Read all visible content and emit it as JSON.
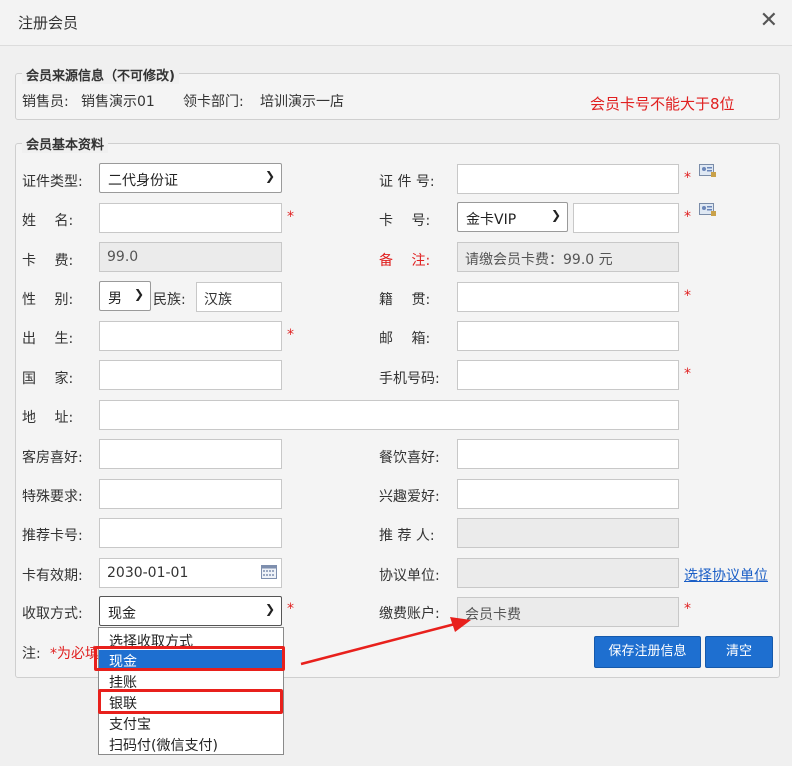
{
  "window": {
    "title": "注册会员",
    "close_icon": "close-icon"
  },
  "source_info": {
    "legend": "会员来源信息（不可修改)",
    "salesperson_label": "销售员:",
    "salesperson_value": "销售演示01",
    "dept_label": "领卡部门:",
    "dept_value": "培训演示一店",
    "warning": "会员卡号不能大于8位"
  },
  "basic": {
    "legend": "会员基本资料",
    "id_type_label": "证件类型:",
    "id_type_value": "二代身份证",
    "id_no_label": "证 件 号:",
    "name_label": "姓　 名:",
    "card_no_label": "卡　 号:",
    "card_type_value": "金卡VIP",
    "fee_label": "卡　 费:",
    "fee_value": "99.0",
    "remark_label": "备　 注:",
    "remark_value": "请缴会员卡费：99.0 元",
    "gender_label": "性　 别:",
    "gender_value": "男",
    "ethnic_label": "民族:",
    "ethnic_value": "汉族",
    "native_label": "籍　 贯:",
    "birth_label": "出　 生:",
    "email_label": "邮　 箱:",
    "country_label": "国　 家:",
    "phone_label": "手机号码:",
    "address_label": "地　 址:",
    "room_pref_label": "客房喜好:",
    "food_pref_label": "餐饮喜好:",
    "special_label": "特殊要求:",
    "hobby_label": "兴趣爱好:",
    "ref_card_label": "推荐卡号:",
    "referrer_label": "推 荐 人:",
    "expiry_label": "卡有效期:",
    "expiry_value": "2030-01-01",
    "agreement_label": "协议单位:",
    "agreement_link": "选择协议单位",
    "pay_method_label": "收取方式:",
    "pay_method_value": "现金",
    "pay_account_label": "缴费账户:",
    "pay_account_value": "会员卡费",
    "note_prefix": "注:",
    "note_star": "*为必填"
  },
  "required_mark": "*",
  "buttons": {
    "save": "保存注册信息",
    "clear": "清空"
  },
  "dropdown": {
    "options": [
      "选择收取方式",
      "现金",
      "挂账",
      "银联",
      "支付宝",
      "扫码付(微信支付)"
    ],
    "selected_index": 1,
    "highlighted": [
      "现金",
      "银联"
    ]
  },
  "colors": {
    "accent": "#1e6fd0",
    "warning": "#e02020",
    "annotation": "#e8201c"
  },
  "icons": {
    "id_reader": "id-card-reader-icon",
    "calendar": "calendar-icon",
    "caret": "chevron-down-icon"
  }
}
